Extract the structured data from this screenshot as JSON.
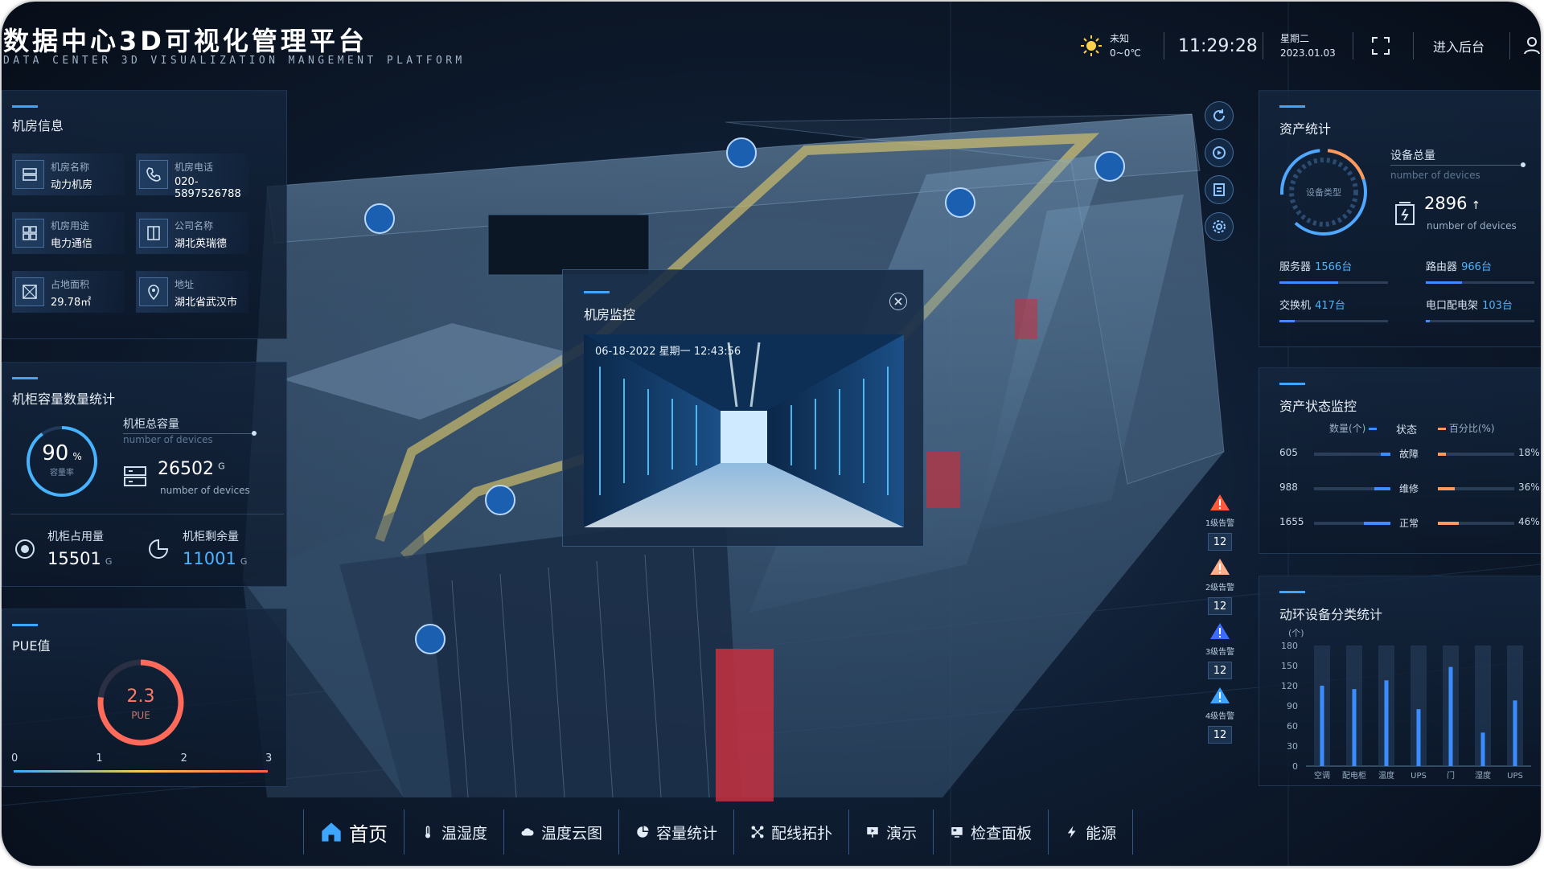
{
  "header": {
    "title": "数据中心3D可视化管理平台",
    "subtitle": "DATA CENTER 3D VISUALIZATION MANGEMENT PLATFORM",
    "weather_label": "未知",
    "weather_range": "0~0℃",
    "time": "11:29:28",
    "weekday": "星期二",
    "date": "2023.01.03",
    "backend_label": "进入后台"
  },
  "room_info": {
    "title": "机房信息",
    "items": [
      {
        "label": "机房名称",
        "value": "动力机房",
        "icon": "server-icon"
      },
      {
        "label": "机房电话",
        "value": "020-5897526788",
        "icon": "phone-icon"
      },
      {
        "label": "机房用途",
        "value": "电力通信",
        "icon": "grid-icon"
      },
      {
        "label": "公司名称",
        "value": "湖北英瑞德",
        "icon": "building-icon"
      },
      {
        "label": "占地面积",
        "value": "29.78㎡",
        "icon": "area-icon"
      },
      {
        "label": "地址",
        "value": "湖北省武汉市",
        "icon": "location-icon"
      }
    ]
  },
  "cabinet": {
    "title": "机柜容量数量统计",
    "rate": "90",
    "rate_unit": "%",
    "rate_label": "容量率",
    "rate_fraction": 0.9,
    "total_label": "机柜总容量",
    "total_sub": "number of devices",
    "total_value": "26502",
    "total_unit": "G",
    "total_desc": "number of devices",
    "used_label": "机柜占用量",
    "used_value": "15501",
    "used_unit": "G",
    "free_label": "机柜剩余量",
    "free_value": "11001",
    "free_unit": "G"
  },
  "pue": {
    "title": "PUE值",
    "value": "2.3",
    "label": "PUE",
    "scale": [
      "0",
      "1",
      "2",
      "3"
    ],
    "fraction": 0.77
  },
  "assets": {
    "title": "资产统计",
    "ring_label": "设备类型",
    "total_label": "设备总量",
    "total_sub": "number of devices",
    "total_value": "2896",
    "total_desc": "number of devices",
    "items": [
      {
        "name": "服务器",
        "value": "1566台",
        "fraction": 0.54
      },
      {
        "name": "路由器",
        "value": "966台",
        "fraction": 0.33
      },
      {
        "name": "交换机",
        "value": "417台",
        "fraction": 0.14
      },
      {
        "name": "电口配电架",
        "value": "103台",
        "fraction": 0.04
      }
    ]
  },
  "asset_status": {
    "title": "资产状态监控",
    "col_count": "数量(个)",
    "col_status": "状态",
    "col_percent": "百分比(%)",
    "rows": [
      {
        "count": "605",
        "status": "故障",
        "percent": "18%",
        "count_frac": 0.36,
        "pct_frac": 0.18
      },
      {
        "count": "988",
        "status": "维修",
        "percent": "36%",
        "count_frac": 0.6,
        "pct_frac": 0.36
      },
      {
        "count": "1655",
        "status": "正常",
        "percent": "46%",
        "count_frac": 1.0,
        "pct_frac": 0.46
      }
    ]
  },
  "env_chart": {
    "title": "动环设备分类统计",
    "chart_data": {
      "type": "bar",
      "ylabel": "(个)",
      "ylim": [
        0,
        180
      ],
      "yticks": [
        "180",
        "150",
        "120",
        "90",
        "60",
        "30",
        "0"
      ],
      "categories": [
        "空调",
        "配电柜",
        "温度",
        "UPS",
        "门",
        "湿度",
        "UPS"
      ],
      "values": [
        120,
        115,
        128,
        85,
        148,
        50,
        98
      ],
      "bar_color": "#3a8dff"
    }
  },
  "monitor": {
    "title": "机房监控",
    "timestamp": "06-18-2022  星期一  12:43:56"
  },
  "alarms": [
    {
      "level": "1级告警",
      "count": "12",
      "color": "#ff5a3c"
    },
    {
      "level": "2级告警",
      "count": "12",
      "color": "#ffb08a"
    },
    {
      "level": "3级告警",
      "count": "12",
      "color": "#3b6cff"
    },
    {
      "level": "4级告警",
      "count": "12",
      "color": "#3ca4ff"
    }
  ],
  "nav": {
    "items": [
      {
        "label": "首页",
        "icon": "home-icon"
      },
      {
        "label": "温湿度",
        "icon": "thermometer-icon"
      },
      {
        "label": "温度云图",
        "icon": "cloud-icon"
      },
      {
        "label": "容量统计",
        "icon": "pie-chart-icon"
      },
      {
        "label": "配线拓扑",
        "icon": "topology-icon"
      },
      {
        "label": "演示",
        "icon": "presentation-icon"
      },
      {
        "label": "检查面板",
        "icon": "panel-icon"
      },
      {
        "label": "能源",
        "icon": "lightning-icon"
      }
    ]
  }
}
